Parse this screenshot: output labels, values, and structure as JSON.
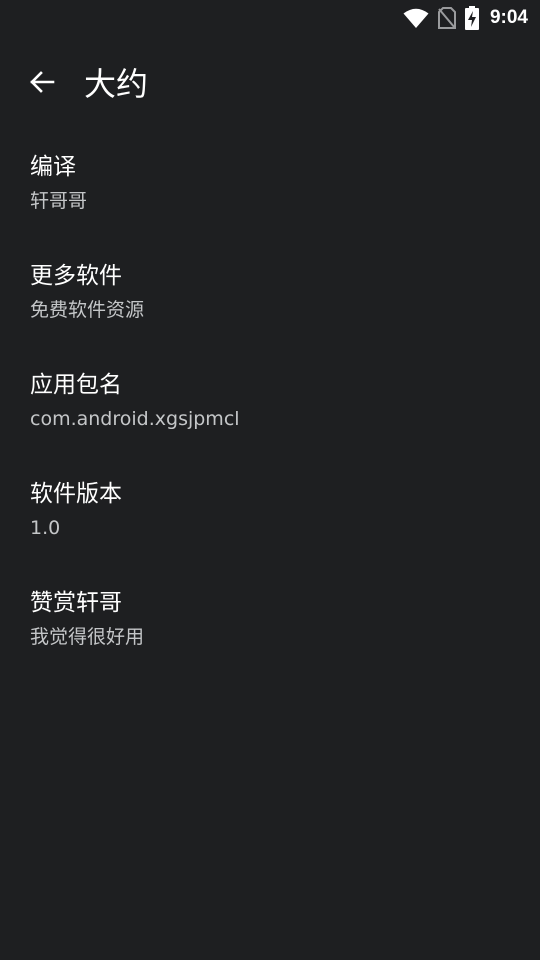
{
  "status_bar": {
    "time": "9:04",
    "icons": [
      "wifi-icon",
      "no-sim-icon",
      "battery-charging-icon"
    ]
  },
  "app_bar": {
    "back_icon": "arrow-left-icon",
    "title": "大约"
  },
  "preferences": [
    {
      "title": "编译",
      "summary": "轩哥哥"
    },
    {
      "title": "更多软件",
      "summary": "免费软件资源"
    },
    {
      "title": "应用包名",
      "summary": "com.android.xgsjpmcl"
    },
    {
      "title": "软件版本",
      "summary": "1.0"
    },
    {
      "title": "赞赏轩哥",
      "summary": "我觉得很好用"
    }
  ],
  "colors": {
    "background": "#1e1f21",
    "title_text": "#ffffff",
    "summary_text": "#c4c6c8"
  }
}
